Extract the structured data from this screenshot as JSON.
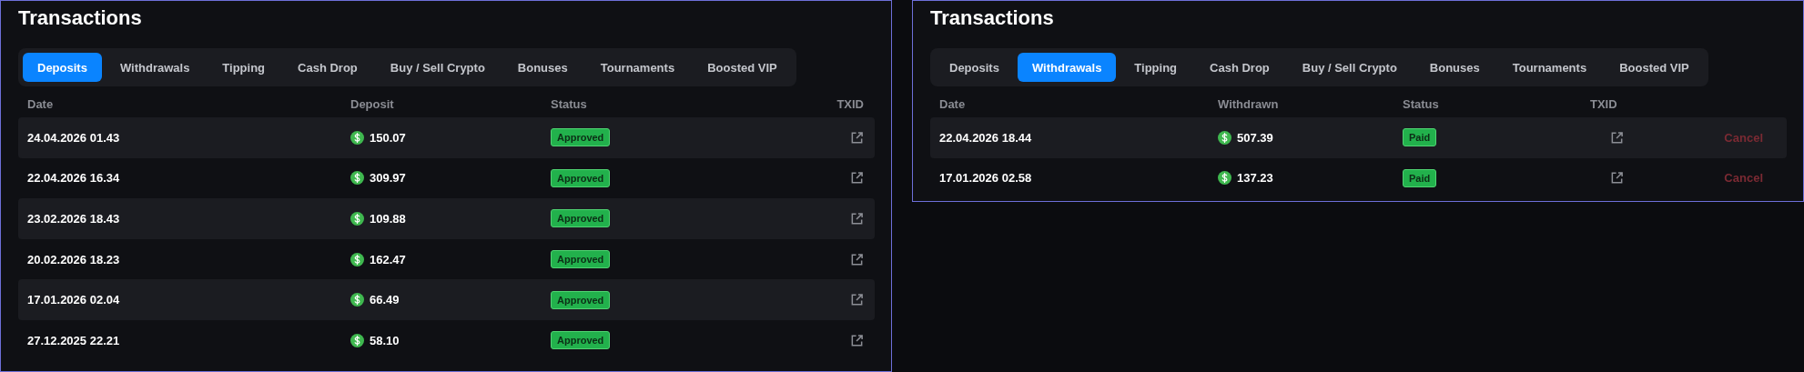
{
  "panels": [
    {
      "title": "Transactions",
      "tabs": [
        {
          "label": "Deposits",
          "selected": true
        },
        {
          "label": "Withdrawals",
          "selected": false
        },
        {
          "label": "Tipping",
          "selected": false
        },
        {
          "label": "Cash Drop",
          "selected": false
        },
        {
          "label": "Buy / Sell Crypto",
          "selected": false
        },
        {
          "label": "Bonuses",
          "selected": false
        },
        {
          "label": "Tournaments",
          "selected": false
        },
        {
          "label": "Boosted VIP",
          "selected": false
        }
      ],
      "columns": [
        "Date",
        "Deposit",
        "Status",
        "TXID"
      ],
      "rows": [
        {
          "date": "24.04.2026 01.43",
          "amount": "150.07",
          "status": "Approved"
        },
        {
          "date": "22.04.2026 16.34",
          "amount": "309.97",
          "status": "Approved"
        },
        {
          "date": "23.02.2026 18.43",
          "amount": "109.88",
          "status": "Approved"
        },
        {
          "date": "20.02.2026 18.23",
          "amount": "162.47",
          "status": "Approved"
        },
        {
          "date": "17.01.2026 02.04",
          "amount": "66.49",
          "status": "Approved"
        },
        {
          "date": "27.12.2025 22.21",
          "amount": "58.10",
          "status": "Approved"
        }
      ]
    },
    {
      "title": "Transactions",
      "tabs": [
        {
          "label": "Deposits",
          "selected": false
        },
        {
          "label": "Withdrawals",
          "selected": true
        },
        {
          "label": "Tipping",
          "selected": false
        },
        {
          "label": "Cash Drop",
          "selected": false
        },
        {
          "label": "Buy / Sell Crypto",
          "selected": false
        },
        {
          "label": "Bonuses",
          "selected": false
        },
        {
          "label": "Tournaments",
          "selected": false
        },
        {
          "label": "Boosted VIP",
          "selected": false
        }
      ],
      "columns": [
        "Date",
        "Withdrawn",
        "Status",
        "TXID"
      ],
      "rows": [
        {
          "date": "22.04.2026 18.44",
          "amount": "507.39",
          "status": "Paid",
          "action": "Cancel"
        },
        {
          "date": "17.01.2026 02.58",
          "amount": "137.23",
          "status": "Paid",
          "action": "Cancel"
        }
      ]
    }
  ]
}
